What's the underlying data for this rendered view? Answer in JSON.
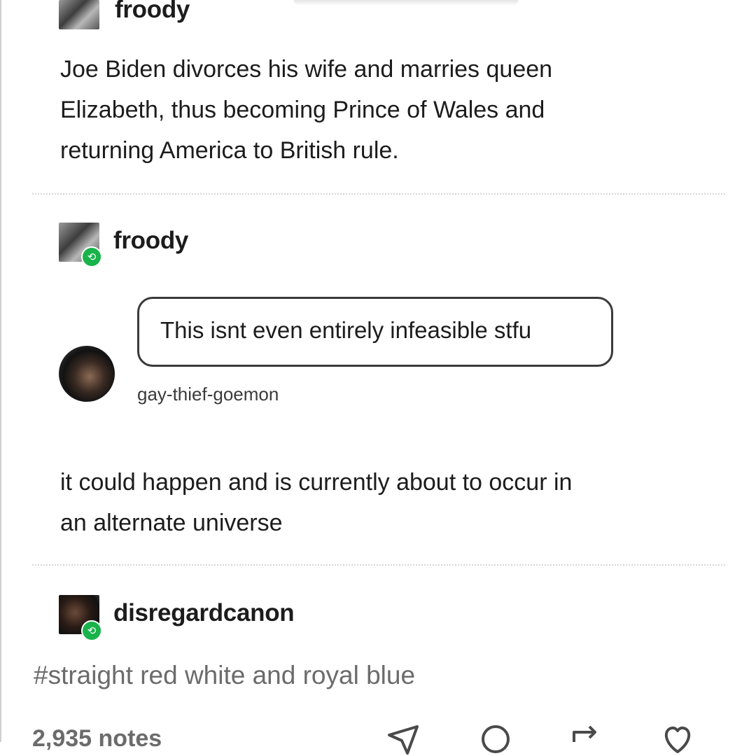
{
  "posts": [
    {
      "username": "froody",
      "lines": [
        "Joe Biden divorces his wife and marries queen",
        "Elizabeth, thus becoming Prince of Wales and",
        "returning America to British rule."
      ]
    },
    {
      "username": "froody",
      "reblog_icon": "reblog-icon",
      "quote": {
        "text": "This isnt even entirely infeasible stfu",
        "author": "gay-thief-goemon"
      },
      "lines": [
        "it could happen and is currently about to occur in",
        "an alternate universe"
      ]
    },
    {
      "username": "disregardcanon",
      "reblog_icon": "reblog-icon",
      "tags": "#straight red white and royal blue"
    }
  ],
  "footer": {
    "notes": "2,935 notes",
    "actions": [
      "share-icon",
      "reply-icon",
      "reblog-icon",
      "like-icon"
    ]
  },
  "colors": {
    "text": "#1c1c1c",
    "muted": "#6b6b6b",
    "reblog_green": "#18b34a"
  }
}
